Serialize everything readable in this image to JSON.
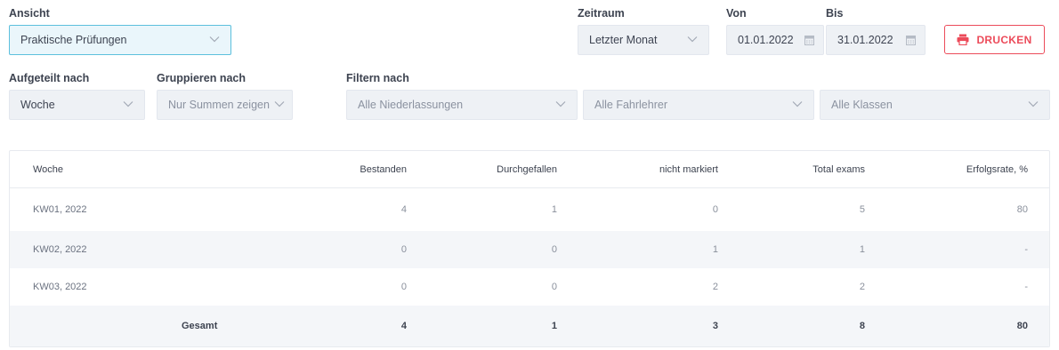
{
  "view": {
    "label": "Ansicht",
    "value": "Praktische Prüfungen"
  },
  "period": {
    "label": "Zeitraum",
    "value": "Letzter Monat"
  },
  "from": {
    "label": "Von",
    "value": "01.01.2022"
  },
  "to": {
    "label": "Bis",
    "value": "31.01.2022"
  },
  "print_button": {
    "label": "DRUCKEN"
  },
  "split_by": {
    "label": "Aufgeteilt nach",
    "value": "Woche"
  },
  "group_by": {
    "label": "Gruppieren nach",
    "value": "Nur Summen zeigen"
  },
  "filter": {
    "label": "Filtern nach",
    "branches": "Alle Niederlassungen",
    "instructors": "Alle Fahrlehrer",
    "classes": "Alle Klassen"
  },
  "table": {
    "headers": [
      "Woche",
      "Bestanden",
      "Durchgefallen",
      "nicht markiert",
      "Total exams",
      "Erfolgsrate, %"
    ],
    "rows": [
      [
        "KW01, 2022",
        "4",
        "1",
        "0",
        "5",
        "80"
      ],
      [
        "KW02, 2022",
        "0",
        "0",
        "1",
        "1",
        "-"
      ],
      [
        "KW03, 2022",
        "0",
        "0",
        "2",
        "2",
        "-"
      ]
    ],
    "total": [
      "Gesamt",
      "4",
      "1",
      "3",
      "8",
      "80"
    ]
  },
  "colors": {
    "accent": "#ec4b5a",
    "active_border": "#5cc0dd"
  }
}
